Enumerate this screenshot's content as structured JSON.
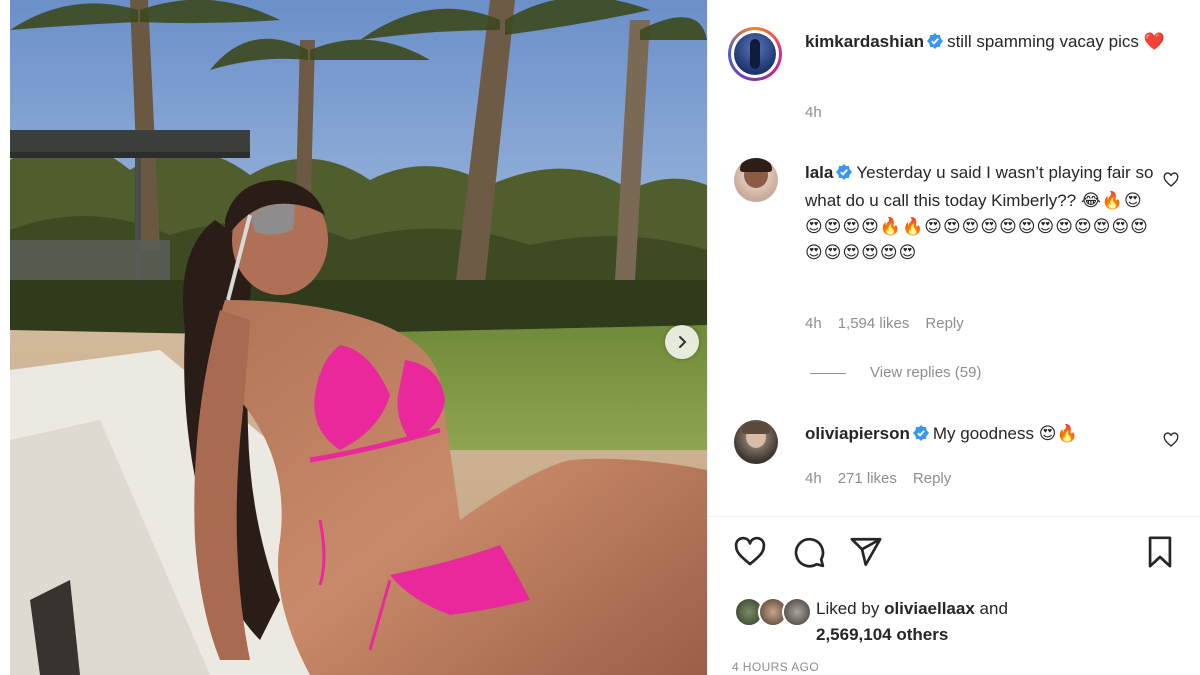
{
  "post": {
    "author": "kimkardashian",
    "caption": "still spamming vacay pics",
    "caption_emoji": "❤️",
    "time": "4h"
  },
  "comments": [
    {
      "user": "lala",
      "text": "Yesterday u said I wasn’t playing fair so what do u call this today Kimberly??",
      "emoji": "😂🔥😍😍😍😍😍🔥🔥😍😍😍😍😍😍😍😍😍😍😍😍😍😍😍😍😍😍",
      "time": "4h",
      "likes": "1,594 likes",
      "reply": "Reply",
      "view_replies": "View replies (59)"
    },
    {
      "user": "oliviapierson",
      "text": "My goodness",
      "emoji": "😍🔥",
      "time": "4h",
      "likes": "271 likes",
      "reply": "Reply"
    }
  ],
  "likes": {
    "prefix": "Liked by",
    "user": "oliviaellaax",
    "and": "and",
    "others": "2,569,104 others"
  },
  "timestamp": "4 HOURS AGO",
  "icons": {
    "next": "chevron-right-icon",
    "like": "heart-icon",
    "comment": "comment-icon",
    "share": "paper-plane-icon",
    "save": "bookmark-icon",
    "verified": "verified-badge-icon"
  },
  "colors": {
    "verified": "#3897f0",
    "bikini": "#e8289b",
    "muted": "#8e8e8e"
  }
}
